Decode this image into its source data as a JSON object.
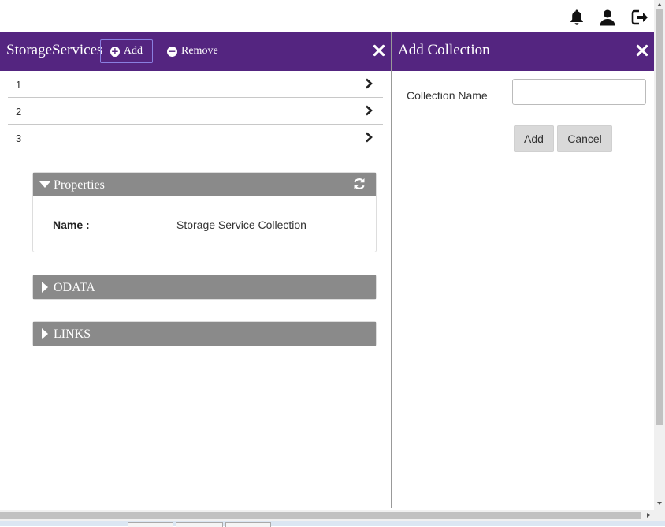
{
  "topbar": {
    "icons": [
      "bell-icon",
      "user-icon",
      "sign-out-icon"
    ]
  },
  "left_panel": {
    "title": "StorageServices",
    "add_label": "Add",
    "remove_label": "Remove",
    "items": [
      {
        "label": "1"
      },
      {
        "label": "2"
      },
      {
        "label": "3"
      }
    ],
    "properties": {
      "title": "Properties",
      "name_label": "Name :",
      "name_value": "Storage Service Collection"
    },
    "odata": {
      "title": "ODATA"
    },
    "links": {
      "title": "LINKS"
    }
  },
  "right_panel": {
    "title": "Add Collection",
    "field_label": "Collection Name",
    "field_value": "",
    "field_placeholder": "",
    "add_label": "Add",
    "cancel_label": "Cancel"
  },
  "colors": {
    "header_bg": "#542580",
    "section_header_bg": "#8a8a8a",
    "button_bg": "#d9d9d9"
  }
}
